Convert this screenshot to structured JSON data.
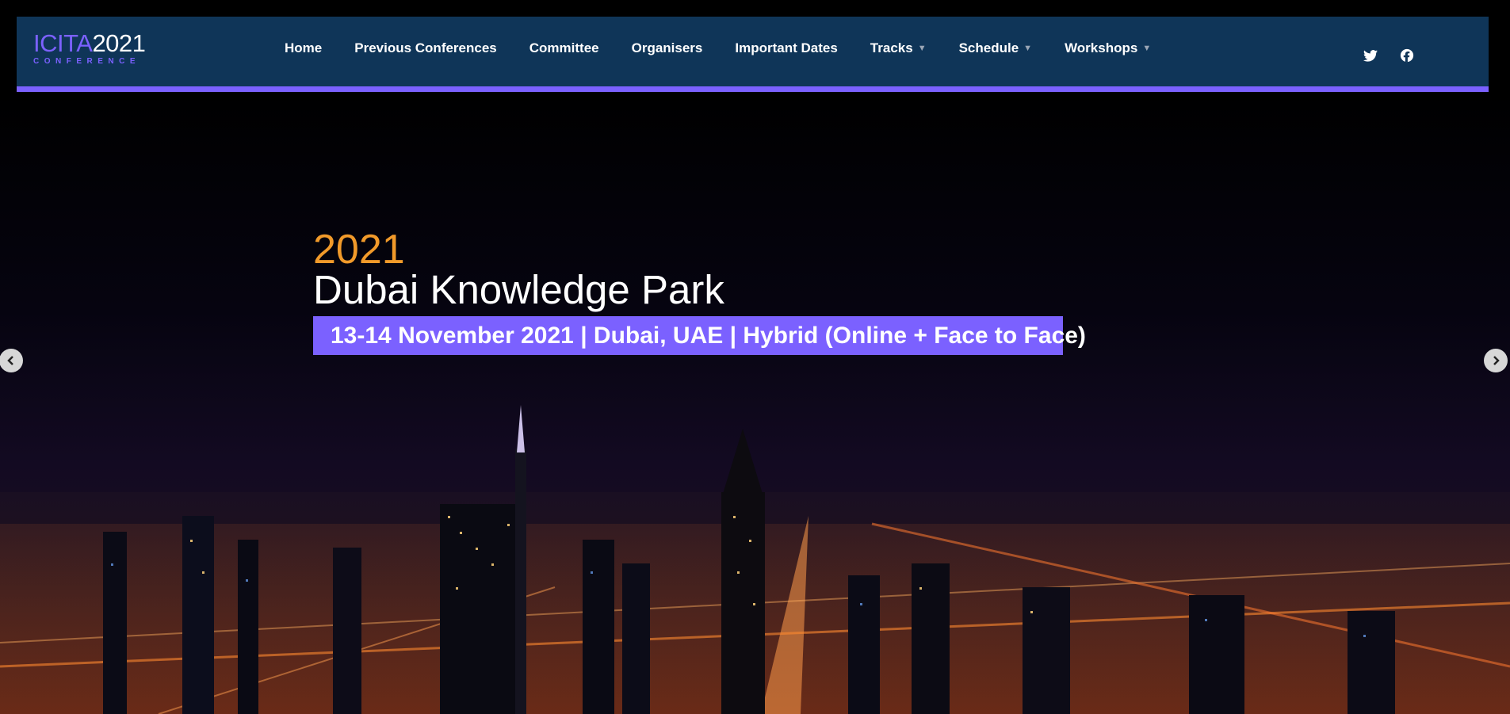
{
  "logo": {
    "acronym": "ICITA",
    "year": "2021",
    "subtitle": "CONFERENCE"
  },
  "nav": {
    "items": [
      {
        "label": "Home",
        "dropdown": false
      },
      {
        "label": "Previous Conferences",
        "dropdown": false
      },
      {
        "label": "Committee",
        "dropdown": false
      },
      {
        "label": "Organisers",
        "dropdown": false
      },
      {
        "label": "Important Dates",
        "dropdown": false
      },
      {
        "label": "Tracks",
        "dropdown": true
      },
      {
        "label": "Schedule",
        "dropdown": true
      },
      {
        "label": "Workshops",
        "dropdown": true
      }
    ],
    "caret": "▼"
  },
  "social": [
    {
      "icon": "twitter-icon"
    },
    {
      "icon": "facebook-icon"
    }
  ],
  "hero": {
    "year": "2021",
    "venue": "Dubai Knowledge Park",
    "banner": "13-14 November 2021 | Dubai, UAE | Hybrid (Online + Face to Face)"
  },
  "colors": {
    "header_bg": "#0f3558",
    "accent": "#7b61ff",
    "year_orange": "#f19a2a"
  }
}
